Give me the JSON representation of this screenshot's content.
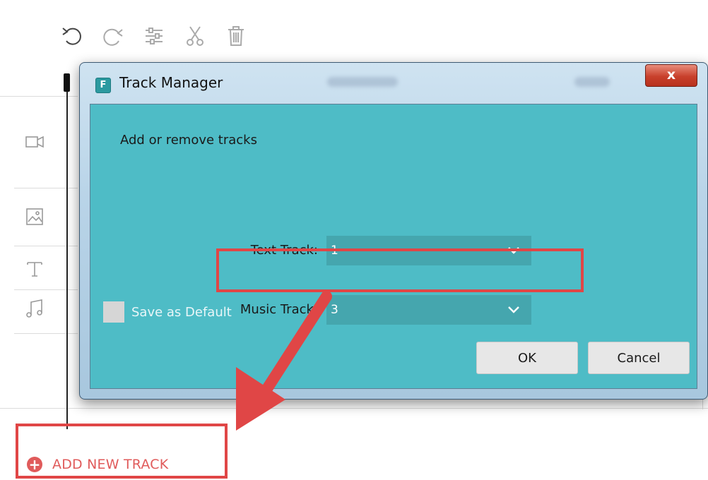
{
  "editor": {
    "toolbar": {
      "icons": [
        "undo-icon",
        "redo-icon",
        "settings-sliders-icon",
        "cut-icon",
        "delete-icon"
      ]
    },
    "side_icons": [
      "video-track-icon",
      "image-track-icon",
      "text-track-icon",
      "music-track-icon"
    ],
    "add_new_track_label": "ADD NEW TRACK",
    "add_icon": "plus-circle-icon",
    "highlight_color": "#e04646",
    "accent_color": "#e05b5b"
  },
  "dialog": {
    "title": "Track Manager",
    "app_icon_letter": "F",
    "close_label": "x",
    "subtitle": "Add or remove tracks",
    "fields": {
      "text_track": {
        "label": "Text Track:",
        "value": "1"
      },
      "music_track": {
        "label": "Music Track:",
        "value": "3"
      }
    },
    "save_default_label": "Save as Default",
    "save_default_checked": false,
    "ok_label": "OK",
    "cancel_label": "Cancel",
    "client_bg": "#4ebcc6",
    "select_bg": "#45a6ae"
  }
}
